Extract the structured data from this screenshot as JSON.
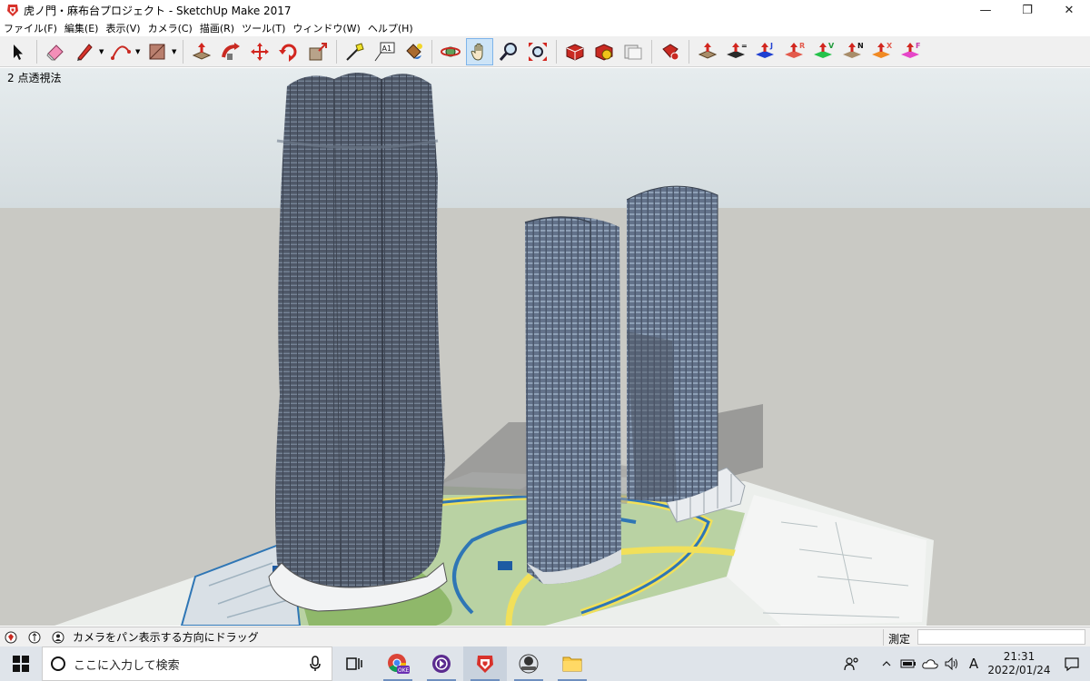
{
  "window": {
    "title": "虎ノ門・麻布台プロジェクト - SketchUp Make 2017",
    "minimize": "—",
    "maximize": "❐",
    "close": "✕"
  },
  "menu": [
    "ファイル(F)",
    "編集(E)",
    "表示(V)",
    "カメラ(C)",
    "描画(R)",
    "ツール(T)",
    "ウィンドウ(W)",
    "ヘルプ(H)"
  ],
  "toolbar": {
    "tools": [
      {
        "name": "select-tool-icon"
      },
      {
        "name": "eraser-tool-icon"
      },
      {
        "name": "pencil-line-tool-icon"
      },
      {
        "name": "arc-tool-icon"
      },
      {
        "name": "rectangle-tool-icon"
      },
      {
        "name": "push-pull-tool-icon"
      },
      {
        "name": "follow-me-tool-icon"
      },
      {
        "name": "move-tool-icon"
      },
      {
        "name": "rotate-tool-icon"
      },
      {
        "name": "scale-tool-icon"
      },
      {
        "name": "tape-measure-tool-icon"
      },
      {
        "name": "text-tool-icon"
      },
      {
        "name": "paint-bucket-tool-icon"
      },
      {
        "name": "orbit-tool-icon"
      },
      {
        "name": "pan-tool-icon"
      },
      {
        "name": "zoom-tool-icon"
      },
      {
        "name": "zoom-extents-tool-icon"
      },
      {
        "name": "3d-warehouse-icon"
      },
      {
        "name": "extension-warehouse-icon"
      },
      {
        "name": "layout-send-icon"
      },
      {
        "name": "extension-manager-icon"
      },
      {
        "name": "push-pull-plus-icon"
      }
    ],
    "text_tool_glyph": "A1",
    "axis_letters": [
      "=",
      "J",
      "R",
      "V",
      "N",
      "X",
      "F"
    ]
  },
  "viewport": {
    "label": "2 点透視法"
  },
  "statusbar": {
    "message": "カメラをパン表示する方向にドラッグ",
    "measure_label": "測定",
    "measure_value": ""
  },
  "taskbar": {
    "search_placeholder": "ここに入力して検索",
    "chrome_badge": "OKE",
    "time": "21:31",
    "date": "2022/01/24",
    "ime": "A",
    "apps": [
      "task-view-icon",
      "chrome-icon",
      "media-player-icon",
      "sketchup-icon",
      "steam-icon",
      "file-explorer-icon"
    ]
  }
}
